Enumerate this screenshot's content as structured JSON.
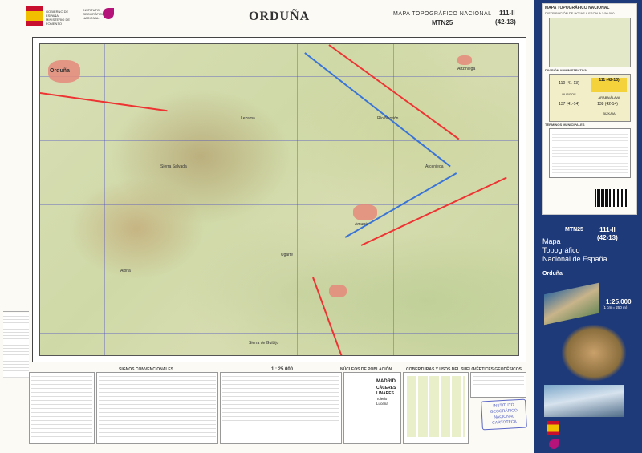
{
  "header": {
    "gov_text": "GOBIERNO DE ESPAÑA",
    "ministry_text": "MINISTERIO DE FOMENTO",
    "ign_text": "INSTITUTO GEOGRÁFICO NACIONAL",
    "map_title": "ORDUÑA",
    "series_title": "MAPA TOPOGRÁFICO NACIONAL",
    "series_code": "MTN25",
    "sheet_number": "111-II",
    "sheet_grid": "(42-13)"
  },
  "map": {
    "labels": [
      "Orduña",
      "Amurrio",
      "Artziniega",
      "Sierra Salvada",
      "Río Nervión",
      "Lezama",
      "Arceniega",
      "Aloria",
      "Ugarte",
      "Sierra de Guibijo"
    ],
    "scale_text": "1 : 25.000"
  },
  "legend": {
    "sections": [
      "SIGNOS CONVENCIONALES",
      "NÚCLEOS DE POBLACIÓN",
      "COBERTURAS Y USOS DEL SUELO",
      "VÉRTICES GEODÉSICOS"
    ],
    "cities": [
      "MADRID",
      "CÁCERES",
      "LINARES",
      "Toledo",
      "Lucena"
    ],
    "stamp_lines": [
      "INSTITUTO GEOGRÁFICO",
      "NACIONAL",
      "CARTOTECA"
    ]
  },
  "side_panel": {
    "top_title": "MAPA TOPOGRÁFICO NACIONAL",
    "top_sub": "DISTRIBUCIÓN DE HOJAS A ESCALA 1:50.000",
    "admin_title": "DIVISIÓN ADMINISTRATIVA",
    "term_title": "TÉRMINOS MUNICIPALES",
    "admin_cells": [
      "110 (41-13)",
      "111 (42-13)",
      "137 (41-14)",
      "138 (42-14)"
    ],
    "admin_regions": [
      "BURGOS",
      "ARABA/ÁLAVA",
      "BIZKAIA"
    ],
    "series_code": "MTN25",
    "sheet_number": "111-II",
    "sheet_grid": "(42-13)",
    "series_title_lines": [
      "Mapa",
      "Topográfico",
      "Nacional de España"
    ],
    "sheet_name": "Orduña",
    "scale": "1:25.000",
    "scale_sub": "(1 cm = 250 m)"
  }
}
